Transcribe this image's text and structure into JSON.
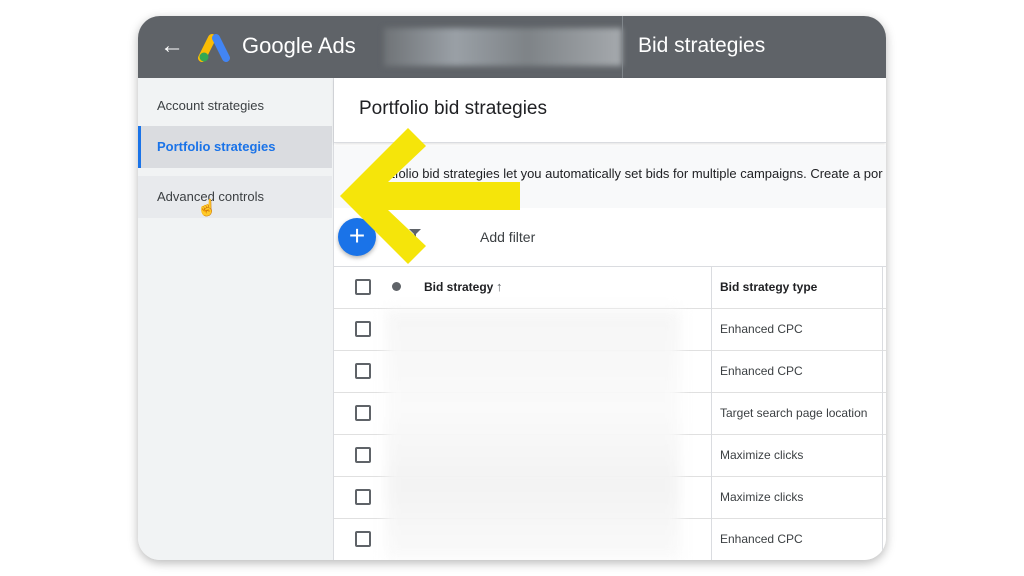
{
  "header": {
    "brand": "Google Ads",
    "page_title": "Bid strategies"
  },
  "sidebar": {
    "items": [
      {
        "label": "Account strategies"
      },
      {
        "label": "Portfolio strategies"
      },
      {
        "label": "Advanced controls"
      }
    ]
  },
  "main": {
    "title": "Portfolio bid strategies",
    "description": "Portfolio bid strategies let you automatically set bids for multiple campaigns. Create a por",
    "add_filter": "Add filter"
  },
  "table": {
    "columns": [
      "Bid strategy",
      "Bid strategy type"
    ],
    "rows": [
      {
        "type": "Enhanced CPC"
      },
      {
        "type": "Enhanced CPC"
      },
      {
        "type": "Target search page location"
      },
      {
        "type": "Maximize clicks"
      },
      {
        "type": "Maximize clicks"
      },
      {
        "type": "Enhanced CPC"
      }
    ]
  },
  "colors": {
    "topbar": "#5f6368",
    "accent": "#1a73e8",
    "arrow": "#f5e50a"
  }
}
